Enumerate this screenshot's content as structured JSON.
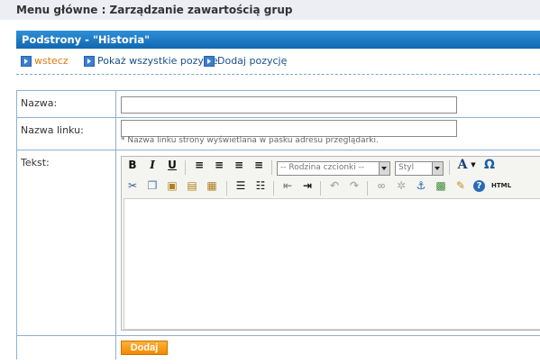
{
  "breadcrumb": "Menu główne : Zarządzanie zawartością grup",
  "panel": {
    "title": "Podstrony - \"Historia\"",
    "links": {
      "back": "wstecz",
      "show_all": "Pokaż wszystkie pozycje",
      "add": "Dodaj pozycję"
    }
  },
  "form": {
    "name_label": "Nazwa:",
    "name_value": "",
    "link_label": "Nazwa linku:",
    "link_value": "",
    "link_hint": "* Nazwa linku strony wyświetlana w pasku adresu przeglądarki.",
    "text_label": "Tekst:",
    "submit_label": "Dodaj"
  },
  "editor": {
    "font_family_placeholder": "-- Rodzina czcionki --",
    "style_placeholder": "Styl",
    "bold_glyph": "B",
    "italic_glyph": "I",
    "underline_glyph": "U",
    "text_color_glyph": "A",
    "special_char_glyph": "Ω",
    "html_glyph": "HTML"
  },
  "colors": {
    "header_blue": "#1a73c0",
    "link_orange": "#e07a10",
    "button_orange": "#f59a1b"
  }
}
